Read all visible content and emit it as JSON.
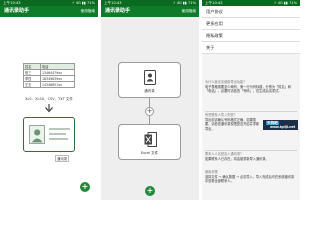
{
  "status": {
    "time": "上午10:43",
    "indicators": "⚡ 4G ▮▮ 71%"
  },
  "app": {
    "title": "通讯录助手",
    "action": "使用指南"
  },
  "screen_import": {
    "table_rows": [
      [
        "姓名",
        "电话"
      ],
      [
        "张三",
        "13464479xx"
      ],
      [
        "李四",
        "18349839xx"
      ],
      [
        "王五",
        "14346851xx"
      ]
    ],
    "formats_text": "XLS、XLSX、CSV、TXT 文件",
    "card_caption": "通讯录",
    "fab_icon": "plus-icon"
  },
  "screen_export": {
    "top_box_label": "通讯录",
    "bottom_box_label": "Excel 文件",
    "plus_glyph": "+",
    "fab_glyph": "+"
  },
  "screen_menu": {
    "items": [
      "用户协议",
      "更多应用",
      "隐私政策",
      "关于"
    ],
    "faq": [
      {
        "q": "为什么我无法使用导出功能？",
        "a": "电子表格需要至少两列，第一行为列标题，分别为「姓名」和「电话」，必要时请检查「号码」，在生成后请重试。"
      },
      {
        "q": "有些联系人导入失败？",
        "a": "导出前请确认号码格式正确，如果需要，请检查通讯录权限是否开启并重新导出。"
      },
      {
        "q": "联系人人名是否入通讯录？",
        "a": "如果联系人已存在，将会被重新导入通讯录。"
      },
      {
        "q": "使用步骤",
        "a": "选择文件 → 确认数据 → 点击导入，导入完成后可在系统通讯录中查看全部联系人。"
      }
    ],
    "badge_top": "天狗吧",
    "badge_bottom": "www.tgiiji.net"
  },
  "colors": {
    "primary": "#0e7b28",
    "primary_dark": "#0b6a1f",
    "accent": "#1e8a3a",
    "highlight": "#d32f2f"
  }
}
